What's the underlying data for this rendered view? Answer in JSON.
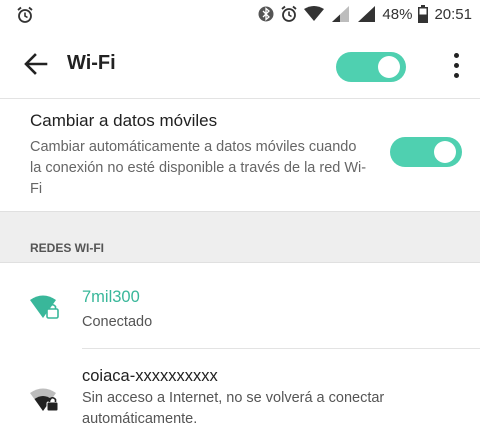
{
  "status_bar": {
    "battery_text": "48%",
    "time": "20:51",
    "icons": [
      "alarm-icon",
      "bluetooth-icon",
      "alarm-icon",
      "wifi-icon",
      "signal-icon",
      "signal-icon",
      "battery-icon"
    ]
  },
  "toolbar": {
    "title": "Wi-Fi",
    "wifi_enabled": true
  },
  "mobile_data": {
    "title": "Cambiar a datos móviles",
    "description": "Cambiar automáticamente a datos móviles cuando la conexión no esté disponible a través de la red Wi-Fi",
    "enabled": true
  },
  "section": {
    "header": "REDES WI-FI"
  },
  "networks": [
    {
      "name": "7mil300",
      "status": "Conectado",
      "connected": true
    },
    {
      "name": "coiaca-xxxxxxxxxx",
      "status": "Sin acceso a Internet, no se volverá a conectar automáticamente.",
      "connected": false
    }
  ],
  "colors": {
    "accent": "#4fd0b0",
    "connected_text": "#39b79a"
  }
}
